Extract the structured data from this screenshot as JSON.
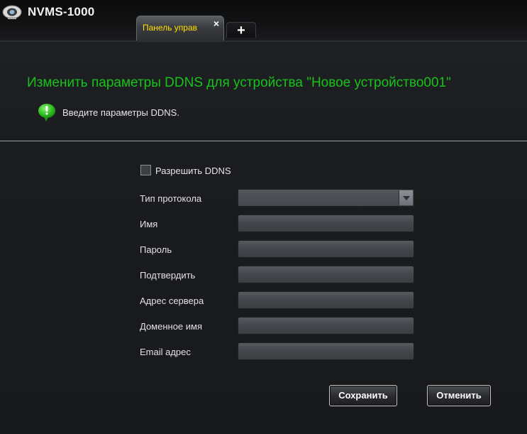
{
  "app": {
    "title": "NVMS-1000",
    "icon": "camera-icon"
  },
  "tabs": [
    {
      "label": "Панель управ",
      "active": true,
      "close_symbol": "×"
    }
  ],
  "tab_add": {
    "symbol": "+"
  },
  "header": {
    "title": "Изменить параметры DDNS для устройства \"Новое устройство001\"",
    "hint_icon": "info-bubble-icon",
    "hint_text": "Введите параметры DDNS."
  },
  "form": {
    "enable_ddns": {
      "label": "Разрешить DDNS",
      "checked": false
    },
    "fields": [
      {
        "key": "protocol",
        "label": "Тип протокола",
        "type": "select",
        "value": ""
      },
      {
        "key": "name",
        "label": "Имя",
        "type": "text",
        "value": ""
      },
      {
        "key": "password",
        "label": "Пароль",
        "type": "password",
        "value": ""
      },
      {
        "key": "confirm",
        "label": "Подтвердить",
        "type": "password",
        "value": ""
      },
      {
        "key": "server",
        "label": "Адрес сервера",
        "type": "text",
        "value": ""
      },
      {
        "key": "domain",
        "label": "Доменное имя",
        "type": "text",
        "value": ""
      },
      {
        "key": "email",
        "label": "Email адрес",
        "type": "text",
        "value": ""
      }
    ]
  },
  "buttons": {
    "save": "Сохранить",
    "cancel": "Отменить"
  },
  "colors": {
    "title_green": "#19c21b",
    "tab_label_yellow": "#ffe200",
    "background": "#17191c"
  }
}
